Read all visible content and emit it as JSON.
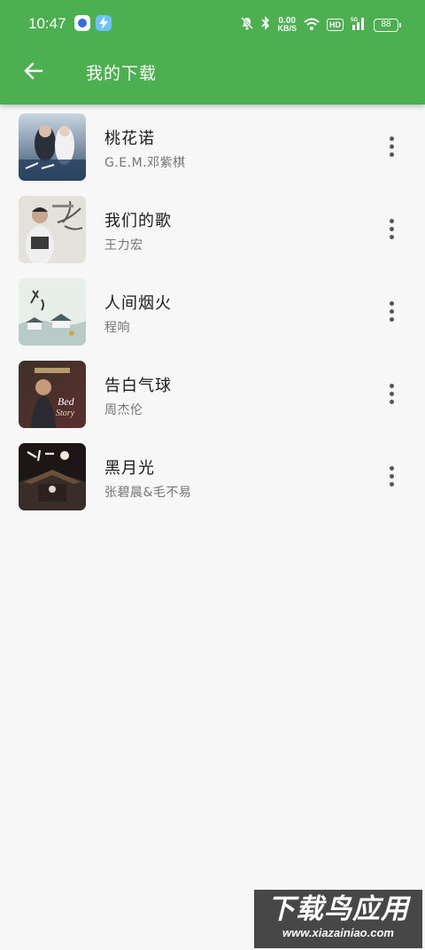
{
  "status_bar": {
    "time": "10:47",
    "net_speed_value": "0.00",
    "net_speed_unit": "KB/S",
    "hd": "HD",
    "network": "5G",
    "battery": "88",
    "icons": [
      "app-notification-icon",
      "flash-icon",
      "mute-icon",
      "bluetooth-icon",
      "wifi-icon",
      "signal-icon",
      "battery-icon"
    ]
  },
  "app_bar": {
    "title": "我的下载",
    "back_icon": "arrow-left-icon",
    "color": "#4caf50"
  },
  "songs": [
    {
      "title": "桃花诺",
      "artist": "G.E.M.邓紫棋"
    },
    {
      "title": "我们的歌",
      "artist": "王力宏"
    },
    {
      "title": "人间烟火",
      "artist": "程响"
    },
    {
      "title": "告白气球",
      "artist": "周杰伦"
    },
    {
      "title": "黑月光",
      "artist": "张碧晨&毛不易"
    }
  ],
  "row_menu_icon": "more-vertical-icon",
  "watermark": {
    "brand": "下载鸟应用",
    "url": "www.xiazainiao.com"
  }
}
